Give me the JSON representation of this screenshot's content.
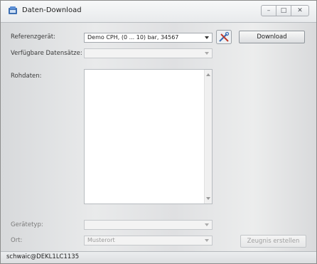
{
  "window": {
    "title": "Daten-Download",
    "controls": {
      "minimize": "–",
      "maximize": "□",
      "close": "✕"
    }
  },
  "form": {
    "referenzgeraet_label": "Referenzgerät:",
    "referenzgeraet_value": "Demo CPH, (0 ... 10) bar, 34567",
    "datensaetze_label": "Verfügbare Datensätze:",
    "datensaetze_value": "",
    "rohdaten_label": "Rohdaten:",
    "rohdaten_value": "",
    "geraetetyp_label": "Gerätetyp:",
    "geraetetyp_value": "",
    "ort_label": "Ort:",
    "ort_value": "Musterort"
  },
  "buttons": {
    "download_label": "Download",
    "zeugnis_label": "Zeugnis erstellen"
  },
  "status": {
    "user": "schwaic@DEKL1LC1135"
  },
  "icons": {
    "app": "app-icon",
    "tool": "tools-icon"
  }
}
